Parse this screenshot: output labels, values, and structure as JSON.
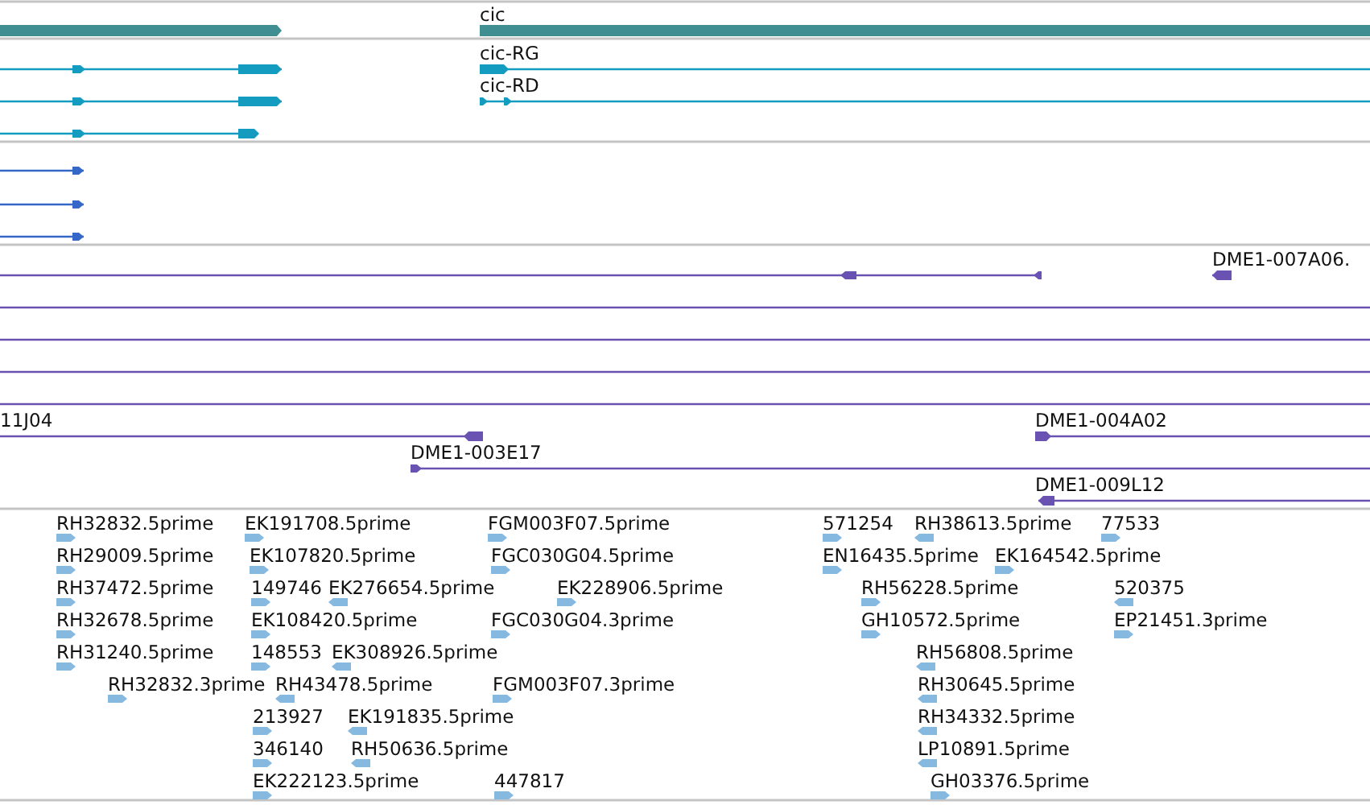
{
  "gene_track": {
    "features": [
      {
        "reverse": false
      },
      {
        "label": "cic",
        "reverse": false
      }
    ]
  },
  "transcript_track": {
    "features": [
      {
        "reverse": false
      },
      {
        "reverse": false
      },
      {
        "reverse": false
      },
      {
        "label": "cic-RG",
        "reverse": false
      },
      {
        "label": "cic-RD",
        "reverse": false
      }
    ]
  },
  "track_3": {
    "features": [
      {
        "reverse": false
      },
      {
        "reverse": false
      },
      {
        "reverse": false
      }
    ]
  },
  "clone_track": {
    "features": [
      {
        "kind": "clone",
        "reverse": true
      },
      {
        "kind": "clone",
        "label": "DME1-007A06.",
        "reverse": true
      },
      {
        "kind": "span"
      },
      {
        "kind": "span"
      },
      {
        "kind": "span"
      },
      {
        "kind": "span"
      },
      {
        "kind": "clone",
        "label": "11J04",
        "reverse": true
      },
      {
        "kind": "clone",
        "label": "DME1-004A02",
        "reverse": false
      },
      {
        "kind": "clone",
        "label": "DME1-003E17",
        "reverse": false
      },
      {
        "kind": "clone",
        "label": "DME1-009L12",
        "reverse": true
      }
    ]
  },
  "est_track": {
    "features": [
      {
        "label": "RH32832.5prime",
        "reverse": false
      },
      {
        "label": "EK191708.5prime",
        "reverse": false
      },
      {
        "label": "FGM003F07.5prime",
        "reverse": false
      },
      {
        "label": "571254",
        "reverse": false
      },
      {
        "label": "RH38613.5prime",
        "reverse": true
      },
      {
        "label": "77533",
        "reverse": false
      },
      {
        "label": "RH29009.5prime",
        "reverse": false
      },
      {
        "label": "EK107820.5prime",
        "reverse": false
      },
      {
        "label": "FGC030G04.5prime",
        "reverse": false
      },
      {
        "label": "EN16435.5prime",
        "reverse": false
      },
      {
        "label": "EK164542.5prime",
        "reverse": false
      },
      {
        "label": "RH37472.5prime",
        "reverse": false
      },
      {
        "label": "149746",
        "reverse": false
      },
      {
        "label": "EK276654.5prime",
        "reverse": true
      },
      {
        "label": "EK228906.5prime",
        "reverse": false
      },
      {
        "label": "RH56228.5prime",
        "reverse": false
      },
      {
        "label": "520375",
        "reverse": true
      },
      {
        "label": "RH32678.5prime",
        "reverse": false
      },
      {
        "label": "EK108420.5prime",
        "reverse": false
      },
      {
        "label": "FGC030G04.3prime",
        "reverse": false
      },
      {
        "label": "GH10572.5prime",
        "reverse": false
      },
      {
        "label": "EP21451.3prime",
        "reverse": false
      },
      {
        "label": "RH31240.5prime",
        "reverse": false
      },
      {
        "label": "148553",
        "reverse": false
      },
      {
        "label": "EK308926.5prime",
        "reverse": true
      },
      {
        "label": "RH56808.5prime",
        "reverse": true
      },
      {
        "label": "RH32832.3prime",
        "reverse": false
      },
      {
        "label": "RH43478.5prime",
        "reverse": true
      },
      {
        "label": "FGM003F07.3prime",
        "reverse": false
      },
      {
        "label": "RH30645.5prime",
        "reverse": true
      },
      {
        "label": "213927",
        "reverse": false
      },
      {
        "label": "EK191835.5prime",
        "reverse": true
      },
      {
        "label": "RH34332.5prime",
        "reverse": true
      },
      {
        "label": "346140",
        "reverse": false
      },
      {
        "label": "RH50636.5prime",
        "reverse": true
      },
      {
        "label": "LP10891.5prime",
        "reverse": true
      },
      {
        "label": "EK222123.5prime",
        "reverse": false
      },
      {
        "label": "447817",
        "reverse": false
      },
      {
        "label": "GH03376.5prime",
        "reverse": false
      }
    ]
  }
}
